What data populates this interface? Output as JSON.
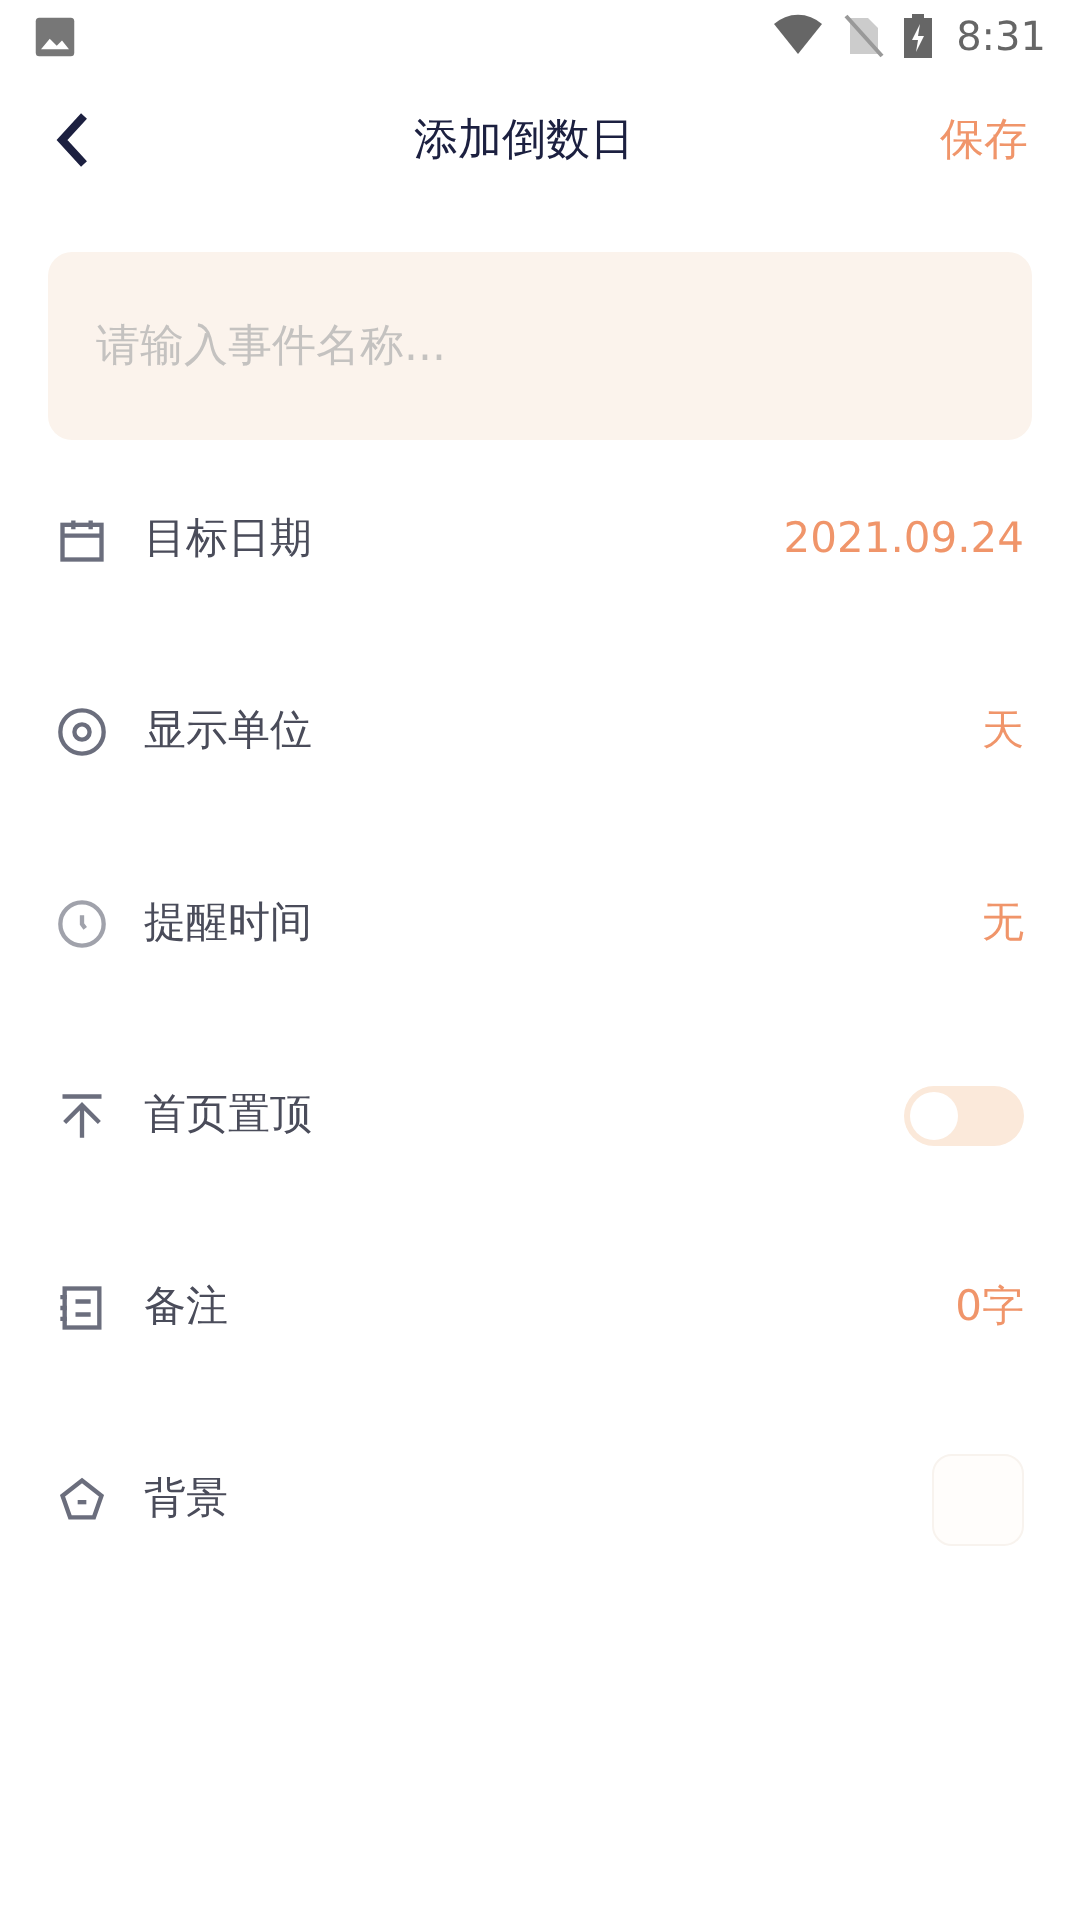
{
  "status_bar": {
    "time": "8:31"
  },
  "header": {
    "title": "添加倒数日",
    "action": "保存"
  },
  "name_field": {
    "placeholder": "请输入事件名称..."
  },
  "rows": [
    {
      "kind": "value",
      "label": "目标日期",
      "value": "2021.09.24"
    },
    {
      "kind": "value",
      "label": "显示单位",
      "value": "天"
    },
    {
      "kind": "value",
      "label": "提醒时间",
      "value": "无"
    },
    {
      "kind": "toggle",
      "label": "首页置顶",
      "on": false
    },
    {
      "kind": "value",
      "label": "备注",
      "value": "0字"
    },
    {
      "kind": "swatch",
      "label": "背景"
    }
  ]
}
